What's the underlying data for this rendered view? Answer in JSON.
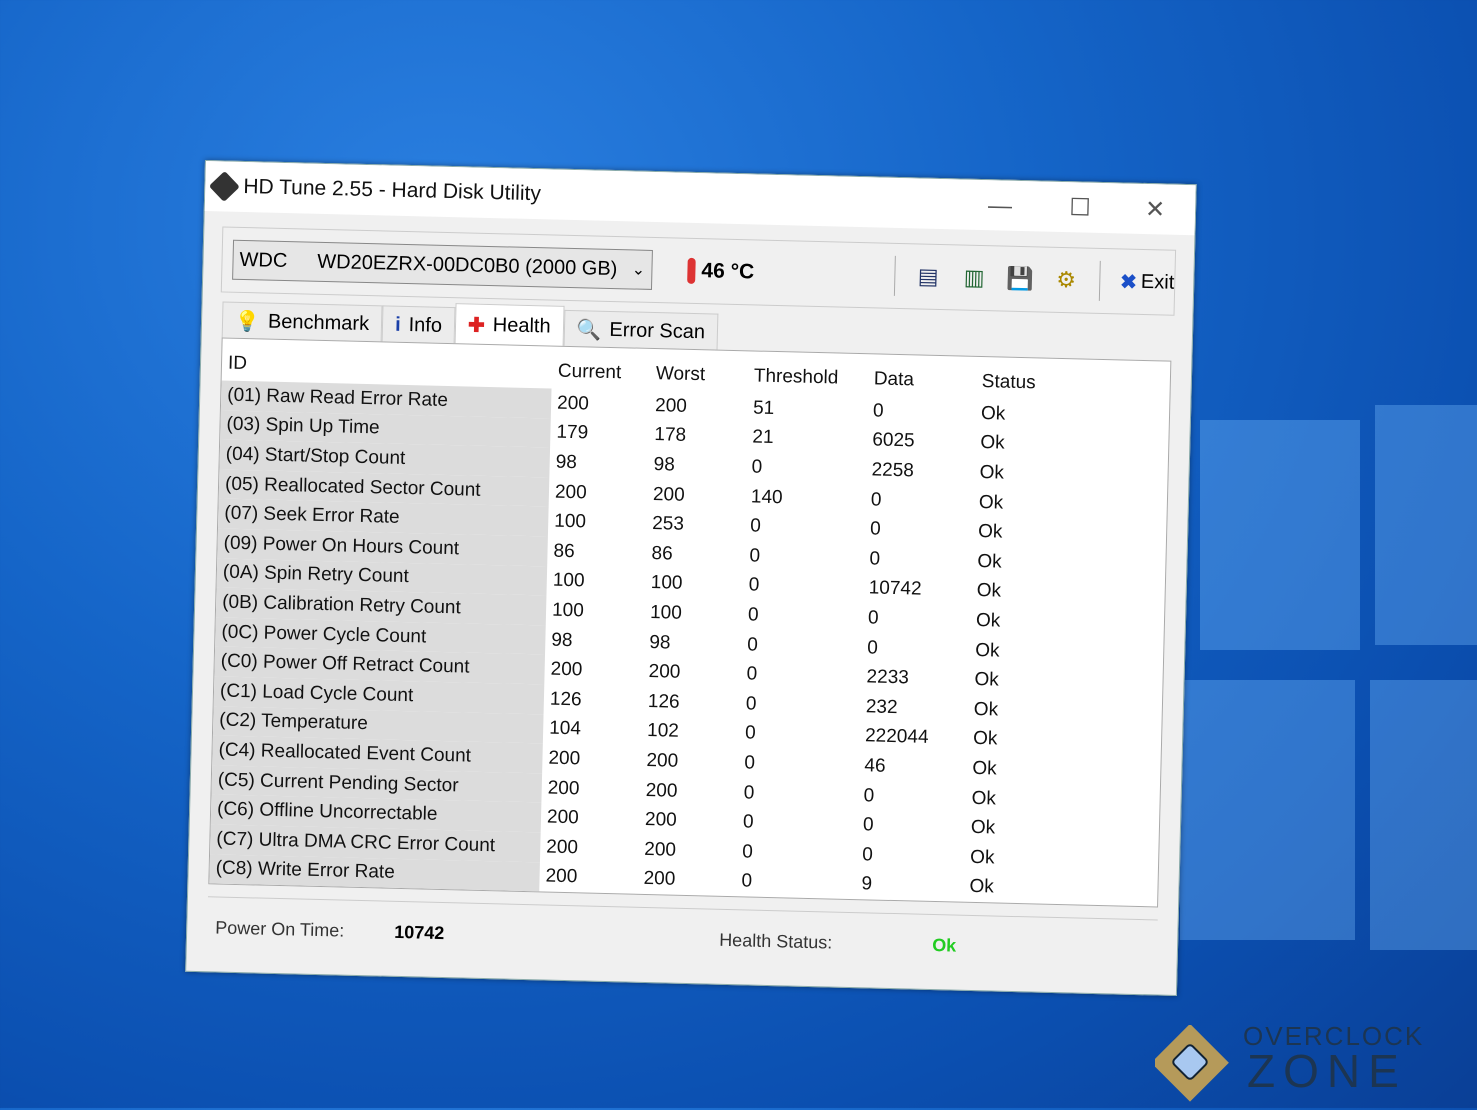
{
  "window": {
    "title": "HD Tune 2.55 - Hard Disk Utility",
    "minimize": "—",
    "maximize": "☐",
    "close": "✕"
  },
  "toolbar": {
    "drive_vendor": "WDC",
    "drive_model": "WD20EZRX-00DC0B0 (2000 GB)",
    "temperature": "46 °C",
    "exit_label": "Exit",
    "icons": [
      "copy-info-icon",
      "copy-all-icon",
      "save-icon",
      "options-icon"
    ]
  },
  "tabs": [
    {
      "label": "Benchmark"
    },
    {
      "label": "Info"
    },
    {
      "label": "Health"
    },
    {
      "label": "Error Scan"
    }
  ],
  "table": {
    "headers": [
      "ID",
      "Current",
      "Worst",
      "Threshold",
      "Data",
      "Status"
    ],
    "rows": [
      [
        "(01) Raw Read Error Rate",
        "200",
        "200",
        "51",
        "0",
        "Ok"
      ],
      [
        "(03) Spin Up Time",
        "179",
        "178",
        "21",
        "6025",
        "Ok"
      ],
      [
        "(04) Start/Stop Count",
        "98",
        "98",
        "0",
        "2258",
        "Ok"
      ],
      [
        "(05) Reallocated Sector Count",
        "200",
        "200",
        "140",
        "0",
        "Ok"
      ],
      [
        "(07) Seek Error Rate",
        "100",
        "253",
        "0",
        "0",
        "Ok"
      ],
      [
        "(09) Power On Hours Count",
        "86",
        "86",
        "0",
        "0",
        "Ok"
      ],
      [
        "(0A) Spin Retry Count",
        "100",
        "100",
        "0",
        "10742",
        "Ok"
      ],
      [
        "(0B) Calibration Retry Count",
        "100",
        "100",
        "0",
        "0",
        "Ok"
      ],
      [
        "(0C) Power Cycle Count",
        "98",
        "98",
        "0",
        "0",
        "Ok"
      ],
      [
        "(C0) Power Off Retract Count",
        "200",
        "200",
        "0",
        "2233",
        "Ok"
      ],
      [
        "(C1) Load Cycle Count",
        "126",
        "126",
        "0",
        "232",
        "Ok"
      ],
      [
        "(C2) Temperature",
        "104",
        "102",
        "0",
        "222044",
        "Ok"
      ],
      [
        "(C4) Reallocated Event Count",
        "200",
        "200",
        "0",
        "46",
        "Ok"
      ],
      [
        "(C5) Current Pending Sector",
        "200",
        "200",
        "0",
        "0",
        "Ok"
      ],
      [
        "(C6) Offline Uncorrectable",
        "200",
        "200",
        "0",
        "0",
        "Ok"
      ],
      [
        "(C7) Ultra DMA CRC Error Count",
        "200",
        "200",
        "0",
        "0",
        "Ok"
      ],
      [
        "(C8) Write Error Rate",
        "200",
        "200",
        "0",
        "9",
        "Ok"
      ]
    ]
  },
  "footer": {
    "power_on_label": "Power On Time:",
    "power_on_value": "10742",
    "health_label": "Health Status:",
    "health_value": "Ok"
  },
  "watermark": {
    "line1": "OVERCLOCK",
    "line2": "ZONE"
  }
}
